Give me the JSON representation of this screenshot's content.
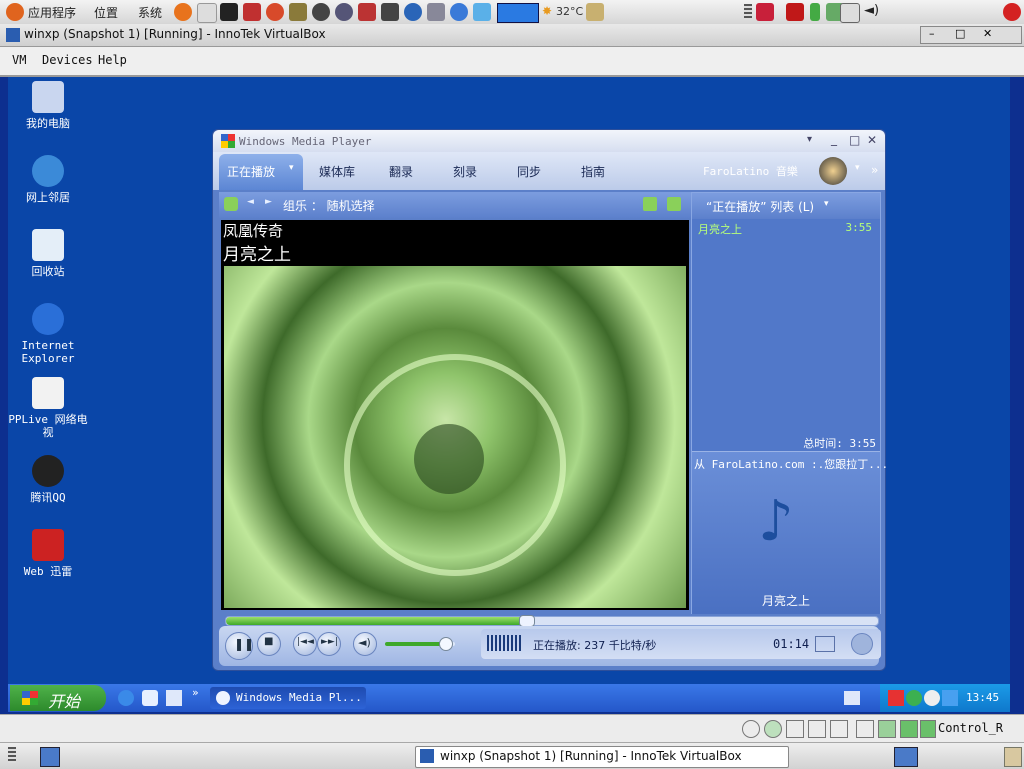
{
  "gnome_panel": {
    "menus": [
      "应用程序",
      "位置",
      "系统"
    ],
    "weather": "32°C",
    "clock": ""
  },
  "vbox": {
    "title": "winxp (Snapshot 1) [Running] - InnoTek VirtualBox",
    "menus": [
      "VM",
      "Devices",
      "Help"
    ],
    "host_key": "Control_R"
  },
  "desktop_icons": [
    "我的电脑",
    "网上邻居",
    "回收站",
    "Internet Explorer",
    "PPLive 网络电视",
    "腾讯QQ",
    "Web 迅雷"
  ],
  "wmp": {
    "title": "Windows Media Player",
    "tabs": [
      "正在播放",
      "媒体库",
      "翻录",
      "刻录",
      "同步",
      "指南"
    ],
    "store": "FaroLatino 音樂",
    "subbar": "组乐 ： 随机选择",
    "video": {
      "album": "凤凰传奇",
      "song": "月亮之上"
    },
    "playlist": {
      "header": "“正在播放” 列表 (L)",
      "items": [
        {
          "name": "月亮之上",
          "duration": "3:55"
        }
      ],
      "total": "总时间: 3:55",
      "info_line": "从 FaroLatino.com :.您跟拉丁...",
      "now_song": "月亮之上"
    },
    "status": "正在播放: 237 千比特/秒",
    "elapsed": "01:14",
    "progress": 0.46,
    "volume": 0.85
  },
  "xp_taskbar": {
    "start_label": "开始",
    "tasks": [
      "Windows Media Pl..."
    ],
    "clock": "13:45"
  },
  "gnome_bottom": {
    "task": "winxp (Snapshot 1) [Running] - InnoTek VirtualBox"
  }
}
